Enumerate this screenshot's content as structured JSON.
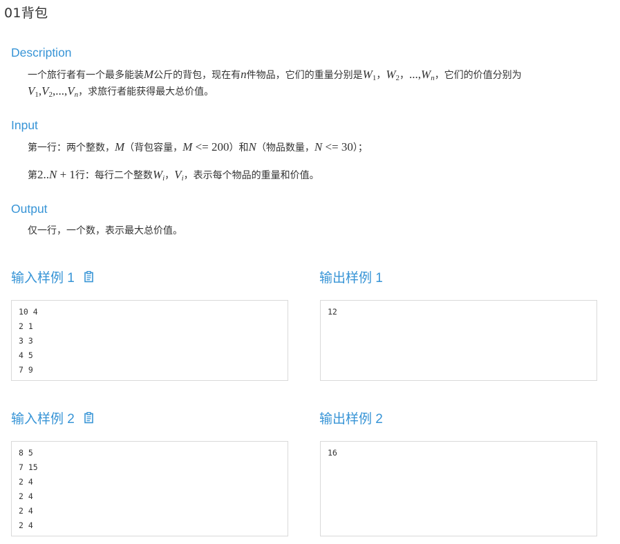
{
  "page": {
    "title": "01背包"
  },
  "sections": {
    "description": {
      "heading": "Description",
      "line1_a": "一个旅行者有一个最多能装",
      "line1_M": "M",
      "line1_b": "公斤的背包，现在有",
      "line1_n": "n",
      "line1_c": "件物品，它们的重量分别是",
      "line1_W1": "W",
      "line1_W1s": "1",
      "line1_sep1": "，",
      "line1_W2": "W",
      "line1_W2s": "2",
      "line1_sep2": "，",
      "line1_dots": "...,",
      "line1_Wn": "W",
      "line1_Wns": "n",
      "line1_d": "，它们的价值分别为",
      "line2_V1": "V",
      "line2_V1s": "1",
      "line2_c1": ",",
      "line2_V2": "V",
      "line2_V2s": "2",
      "line2_c2": ",",
      "line2_dots": "...,",
      "line2_Vn": "V",
      "line2_Vns": "n",
      "line2_text": "，求旅行者能获得最大总价值。"
    },
    "input": {
      "heading": "Input",
      "l1_a": "第一行：两个整数，",
      "l1_M": "M",
      "l1_b": "（背包容量，",
      "l1_M2": "M",
      "l1_le1": " <= 200",
      "l1_c": "）和",
      "l1_N": "N",
      "l1_d": "（物品数量，",
      "l1_N2": "N",
      "l1_le2": " <= 30",
      "l1_e": "）；",
      "l2_a": "第",
      "l2_range": "2..",
      "l2_N": "N",
      "l2_plus": " + 1",
      "l2_b": "行：每行二个整数",
      "l2_W": "W",
      "l2_Ws": "i",
      "l2_sep": "，",
      "l2_V": "V",
      "l2_Vs": "i",
      "l2_c": "，表示每个物品的重量和价值。"
    },
    "output": {
      "heading": "Output",
      "text": "仅一行，一个数，表示最大总价值。"
    }
  },
  "samples": [
    {
      "input_label": "输入样例 1",
      "output_label": "输出样例 1",
      "input": "10 4\n2 1\n3 3\n4 5\n7 9",
      "output": "12"
    },
    {
      "input_label": "输入样例 2",
      "output_label": "输出样例 2",
      "input": "8 5\n7 15\n2 4\n2 4\n2 4\n2 4",
      "output": "16"
    }
  ],
  "icons": {
    "copy": "clipboard-icon"
  },
  "colors": {
    "accent": "#3794d6",
    "text": "#333333",
    "border": "#d9d9d9"
  }
}
